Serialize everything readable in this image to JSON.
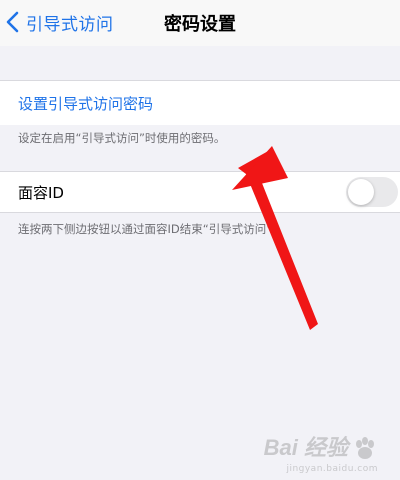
{
  "navbar": {
    "back_label": "引导式访问",
    "title": "密码设置"
  },
  "passcode_section": {
    "link_label": "设置引导式访问密码",
    "footnote": "设定在启用“引导式访问”时使用的密码。"
  },
  "faceid_section": {
    "label": "面容ID",
    "toggle_on": false,
    "footnote": "连按两下侧边按钮以通过面容ID结束“引导式访问”。"
  },
  "annotation": {
    "arrow_color": "#f01616"
  },
  "watermark": {
    "text": "Bai 经验",
    "sub": "jingyan.baidu.com"
  },
  "colors": {
    "accent": "#1f73e8",
    "background": "#f2f2f7",
    "toggle_off": "#e9e9eb"
  }
}
